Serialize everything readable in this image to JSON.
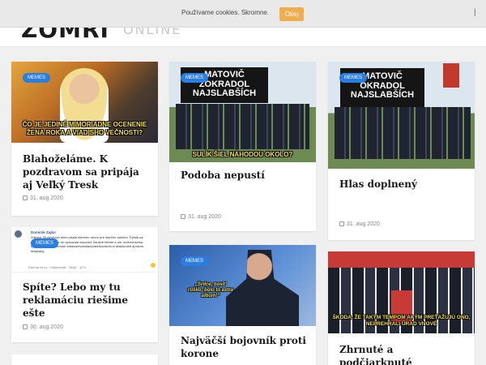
{
  "cookie": {
    "text": "Používame cookies. Skromne.",
    "button": "Okej",
    "close": "|"
  },
  "header": {
    "logo_main": "ZOMRI",
    "logo_sub": "ONLINE"
  },
  "badge_label": "MEMES",
  "colors": {
    "badge": "#2a7de1",
    "cookie_button": "#f0ad4e"
  },
  "cards": [
    {
      "title": "Blahoželáme. K pozdravom sa pripája aj Veľký Tresk",
      "date": "31. aug 2020",
      "caption": "ČO JE JEDINÉ MIMORIADNE OCENENIE ŽENA ROKA A VIADISHO VEČNOSTI?"
    },
    {
      "title": "Podoba nepustí",
      "date": "31. aug 2020",
      "billboard": "MATOVIČ ZOKRADOL NAJSLABŠÍCH",
      "caption": "SULÍK ŠIEL NÁHODOU OKOLO?"
    },
    {
      "title": "Hlas doplnený",
      "date": "31. aug 2020",
      "billboard": "MATOVIČ OKRADOL NAJSLABŠÍCH"
    },
    {
      "title": "Spíte? Lebo my tu reklamáciu riešime ešte",
      "date": "30. aug 2020",
      "post_author": "Dominik Zajko",
      "post_text": "Zdenka Studenková dnes pisala starému otcovi pre starého admina. Pýtala sa, že ako je možné, že už vymazala odpoveď Zaušne Meme a nie. #memetichka #paskymimafiy #nemam #dnesaelvasdlazodstelkovitochon #fakticoleb #pravek #bigbang",
      "post_actions": "Páči sa mi to · Odpovedať · Skryť · 10 h"
    },
    {
      "title": "Najväčší bojovník proti korone",
      "date": "",
      "caption": "„Srdce, nosiť rúško; bolo to extra album!“"
    },
    {
      "title": "Zhrnuté a podčiarknuté",
      "date": "",
      "caption": "ŠKODA, ŽE TAKÝM TEMPOM AKÝM PREŤAŽUJÚ ONO, NEPREHRALI ÚRAD VNOVÉ"
    }
  ]
}
